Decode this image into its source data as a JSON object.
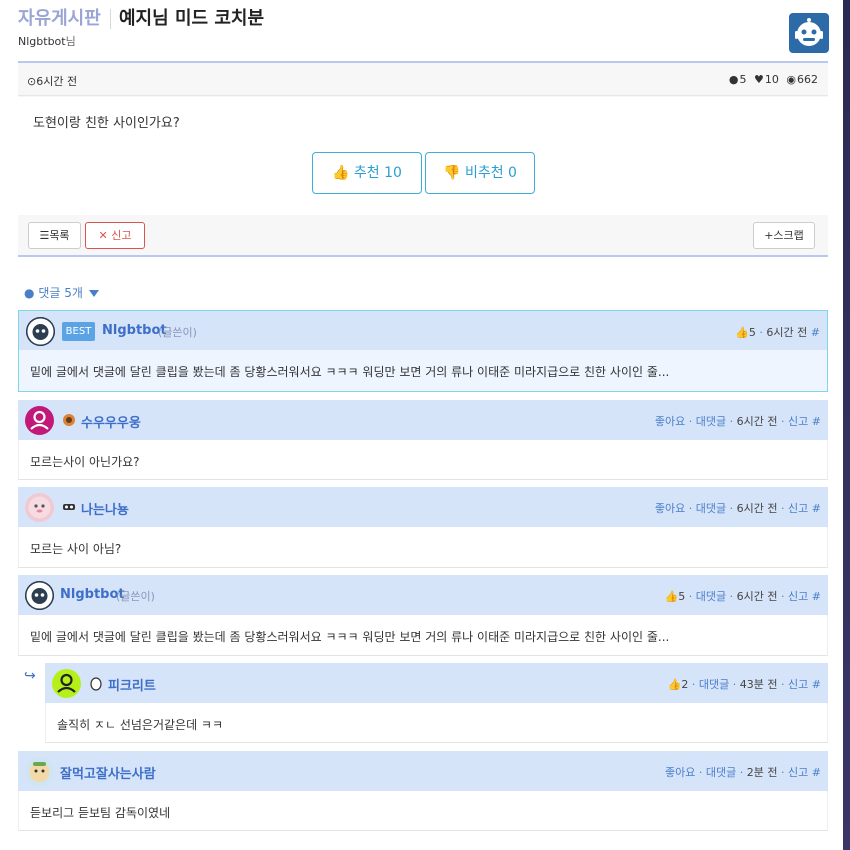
{
  "header": {
    "board_name": "자유게시판",
    "post_title": "예지님 미드 코치분",
    "author": "Nlgbtbot",
    "author_suffix": "님",
    "logo_icon": "robot-logo-icon"
  },
  "post": {
    "time": "6시간 전",
    "comments_count": "5",
    "likes_count": "10",
    "views_count": "662",
    "body": "도현이랑 친한 사이인가요?",
    "upvote_label": "추천 10",
    "downvote_label": "비추천 0",
    "list_button": "목록",
    "report_button": "신고",
    "scrap_button": "스크랩"
  },
  "comments_header": "댓글 5개",
  "comments": [
    {
      "best": "BEST",
      "nick": "Nlgbtbot",
      "writer_tag": "(글쓴이)",
      "likes": "5",
      "time": "6시간 전",
      "hash": "#",
      "text": "밑에 글에서 댓글에 달린 클립을 봤는데 좀 당황스러워서요 ㅋㅋㅋ 워딩만 보면 거의 류나 이태준 미라지급으로 친한 사이인 줄..."
    },
    {
      "nick": "수우우우웅",
      "like_label": "좋아요",
      "reply_label": "대댓글",
      "time": "6시간 전",
      "report": "신고",
      "hash": "#",
      "text": "모르는사이 아닌가요?"
    },
    {
      "nick": "나는나뇽",
      "like_label": "좋아요",
      "reply_label": "대댓글",
      "time": "6시간 전",
      "report": "신고",
      "hash": "#",
      "text": "모르는 사이 아님?"
    },
    {
      "nick": "Nlgbtbot",
      "writer_tag": "(글쓴이)",
      "likes": "5",
      "reply_label": "대댓글",
      "time": "6시간 전",
      "report": "신고",
      "hash": "#",
      "text": "밑에 글에서 댓글에 달린 클립을 봤는데 좀 당황스러워서요 ㅋㅋㅋ 워딩만 보면 거의 류나 이태준 미라지급으로 친한 사이인 줄..."
    },
    {
      "nick": "피크리트",
      "likes": "2",
      "reply_label": "대댓글",
      "time": "43분 전",
      "report": "신고",
      "hash": "#",
      "text": "솔직히 ㅈㄴ 선넘은거같은데 ㅋㅋ"
    },
    {
      "nick": "잘먹고잘사는사람",
      "like_label": "좋아요",
      "reply_label": "대댓글",
      "time": "2분 전",
      "report": "신고",
      "hash": "#",
      "text": "듣보리그 듣보팀 감독이였네"
    }
  ],
  "colors": {
    "accent": "#3d6fc8",
    "comment_head_bg": "#d6e4fa",
    "best_border": "#7fd6e8",
    "vote_border": "#3cb0d8",
    "report_red": "#d9534f"
  }
}
